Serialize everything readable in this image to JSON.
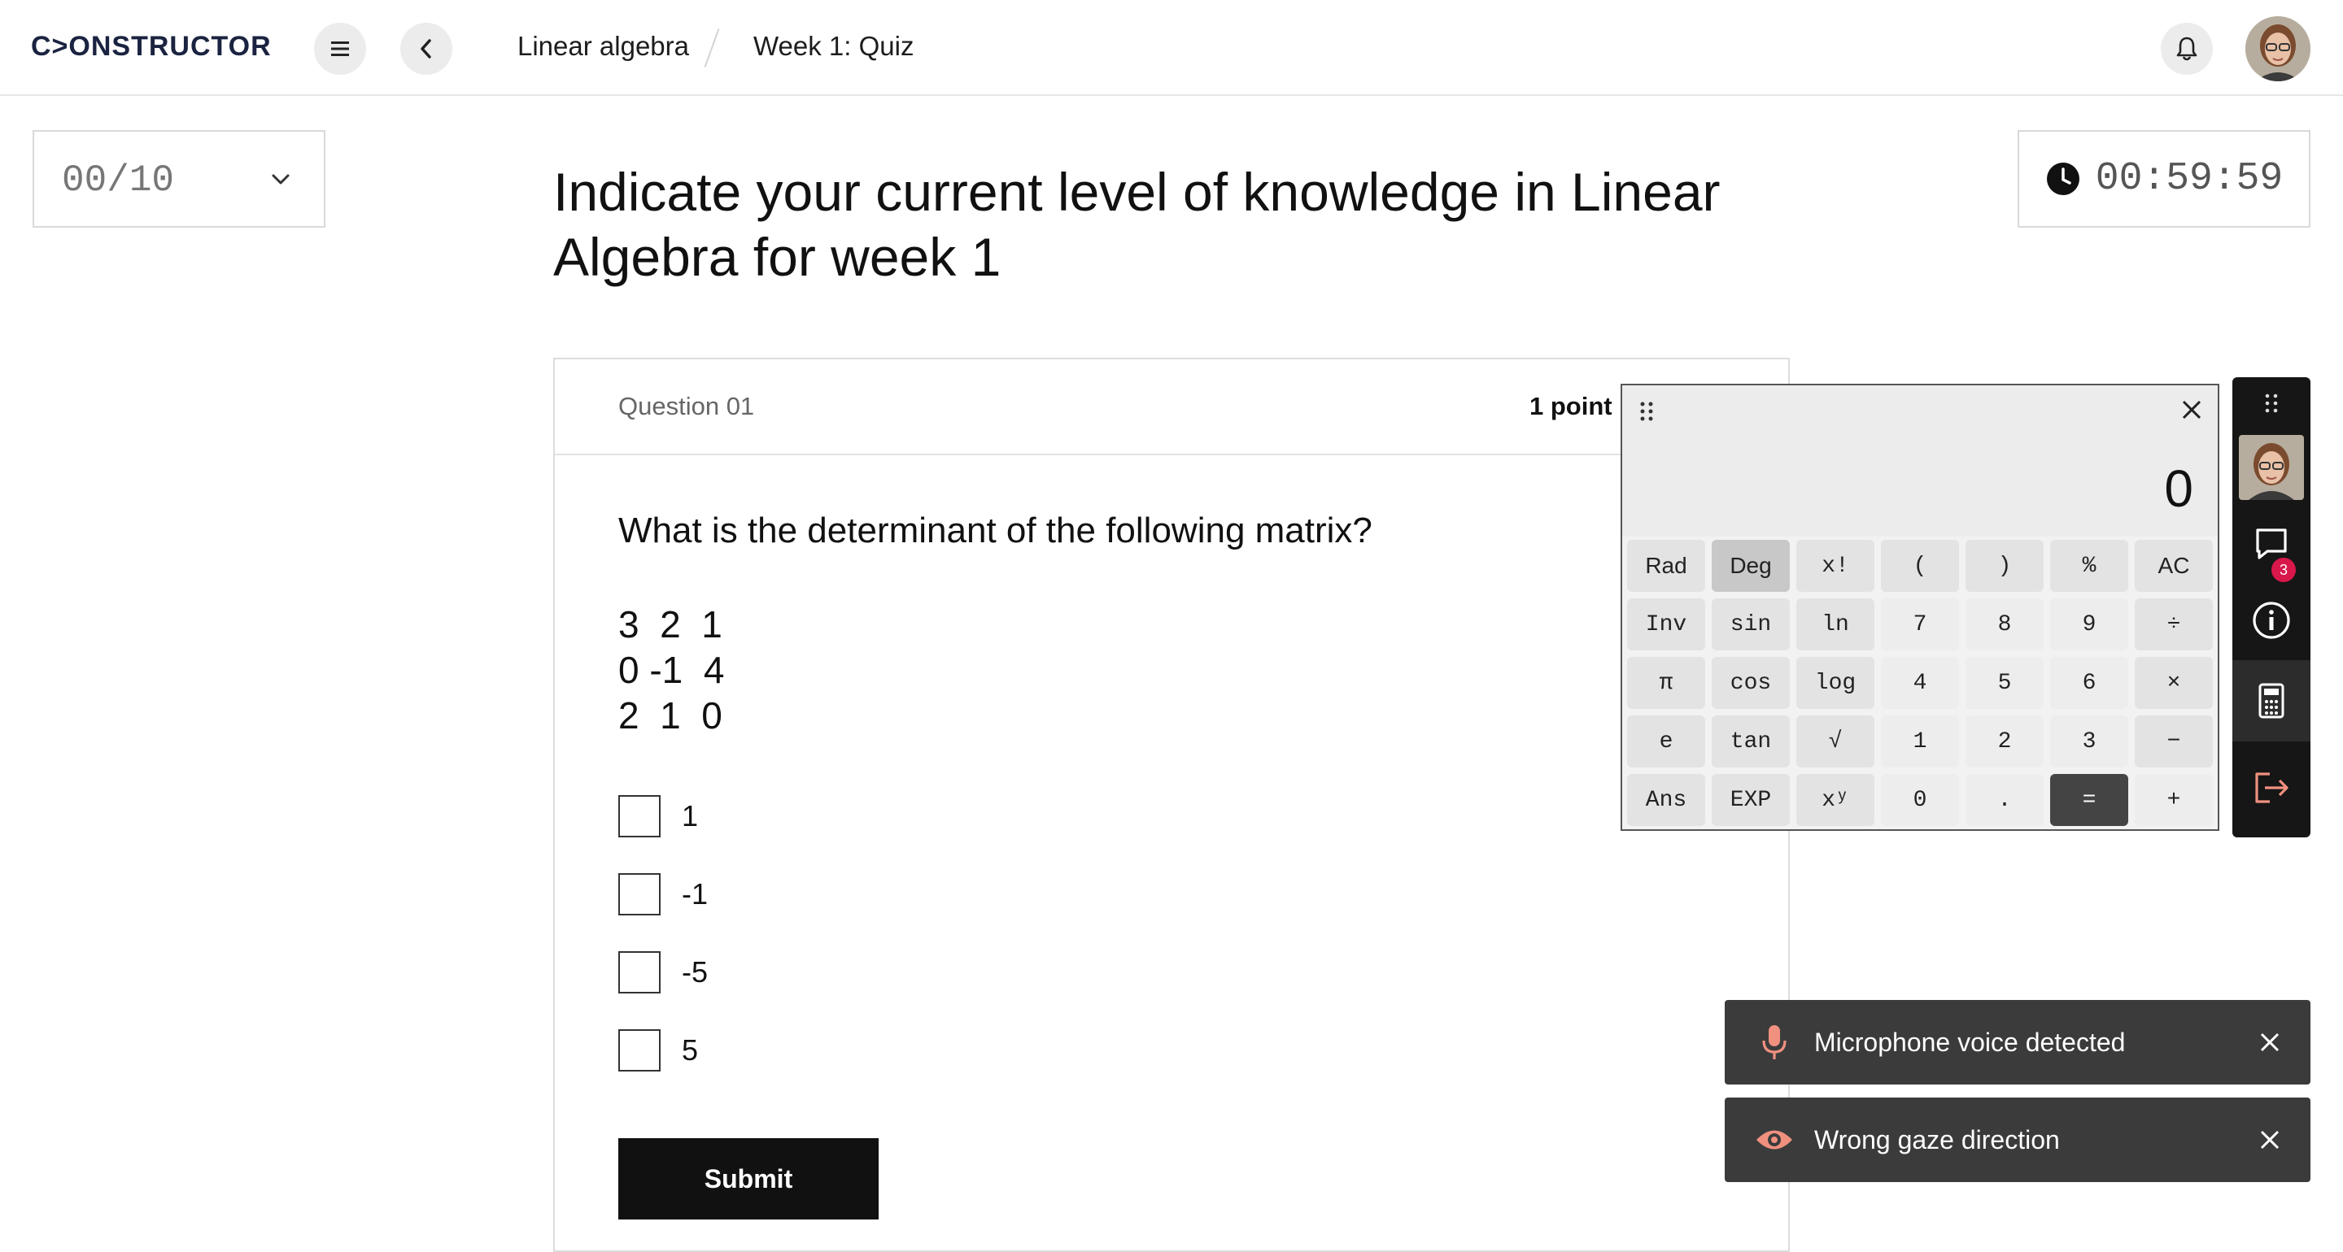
{
  "header": {
    "logo": "C>ONSTRUCTOR",
    "breadcrumb": [
      "Linear algebra",
      "Week 1: Quiz"
    ]
  },
  "question_selector": {
    "value": "00/10"
  },
  "timer": {
    "value": "00:59:59"
  },
  "page_title": "Indicate your current level of knowledge in Linear Algebra for week 1",
  "question": {
    "number": "Question 01",
    "points": "1 point",
    "text": "What is the determinant of the following matrix?",
    "matrix": "3  2  1\n0 -1  4\n2  1  0",
    "options": [
      "1",
      "-1",
      "-5",
      "5"
    ],
    "submit_label": "Submit"
  },
  "calculator": {
    "display": "0",
    "keys": [
      "Rad",
      "Deg",
      "x!",
      "(",
      ")",
      "%",
      "AC",
      "Inv",
      "sin",
      "ln",
      "7",
      "8",
      "9",
      "÷",
      "π",
      "cos",
      "log",
      "4",
      "5",
      "6",
      "×",
      "e",
      "tan",
      "√",
      "1",
      "2",
      "3",
      "−",
      "Ans",
      "EXP",
      "xʸ",
      "0",
      ".",
      "=",
      "+"
    ]
  },
  "sidebar": {
    "chat_badge": "3"
  },
  "toasts": [
    {
      "text": "Microphone voice detected",
      "icon": "microphone-icon"
    },
    {
      "text": "Wrong gaze direction",
      "icon": "eye-icon"
    }
  ],
  "colors": {
    "accent_toast_icon": "#f0907f",
    "badge": "#d8174a",
    "toast_bg": "#3b3b3b"
  }
}
